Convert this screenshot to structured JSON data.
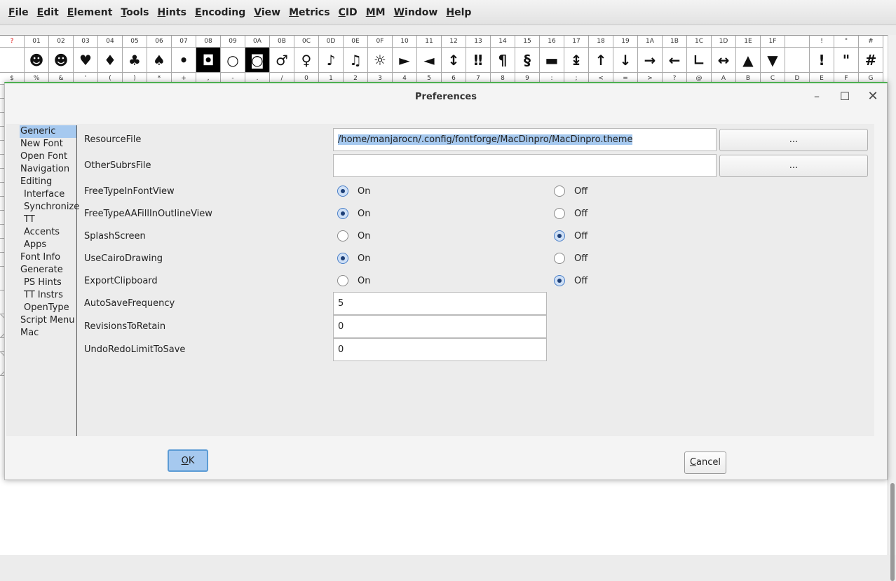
{
  "menubar": {
    "items": [
      {
        "mn": "F",
        "rest": "ile"
      },
      {
        "mn": "E",
        "rest": "dit"
      },
      {
        "mn": "E",
        "rest": "lement"
      },
      {
        "mn": "T",
        "rest": "ools"
      },
      {
        "mn": "H",
        "rest": "ints"
      },
      {
        "mn": "E",
        "rest": "ncoding"
      },
      {
        "mn": "V",
        "rest": "iew"
      },
      {
        "mn": "M",
        "rest": "etrics"
      },
      {
        "mn": "C",
        "rest": "ID"
      },
      {
        "mn": "M",
        "rest": "M"
      },
      {
        "mn": "W",
        "rest": "indow"
      },
      {
        "mn": "H",
        "rest": "elp"
      }
    ]
  },
  "fontview": {
    "labels": [
      "?",
      "01",
      "02",
      "03",
      "04",
      "05",
      "06",
      "07",
      "08",
      "09",
      "0A",
      "0B",
      "0C",
      "0D",
      "0E",
      "0F",
      "10",
      "11",
      "12",
      "13",
      "14",
      "15",
      "16",
      "17",
      "18",
      "19",
      "1A",
      "1B",
      "1C",
      "1D",
      "1E",
      "1F",
      "",
      "!",
      "\"",
      "#"
    ],
    "glyphs": [
      "",
      "☻",
      "☻",
      "♥",
      "♦",
      "♣",
      "♠",
      "•",
      "◘",
      "○",
      "◙",
      "♂",
      "♀",
      "♪",
      "♫",
      "☼",
      "►",
      "◄",
      "↕",
      "‼",
      "¶",
      "§",
      "▬",
      "↨",
      "↑",
      "↓",
      "→",
      "←",
      "∟",
      "↔",
      "▲",
      "▼",
      "",
      "!",
      "\"",
      "#"
    ],
    "labels2": [
      "$",
      "%",
      "&",
      "'",
      "(",
      ")",
      "*",
      "+",
      ",",
      "-",
      ".",
      "/",
      "0",
      "1",
      "2",
      "3",
      "4",
      "5",
      "6",
      "7",
      "8",
      "9",
      ":",
      ";",
      "<",
      "=",
      ">",
      "?",
      "@",
      "A",
      "B",
      "C",
      "D",
      "E",
      "F",
      "G"
    ]
  },
  "dialog": {
    "title": "Preferences",
    "controls": {
      "minimize": "–",
      "maximize": "☐",
      "close": "✕"
    },
    "sidebar": [
      {
        "label": "Generic",
        "sub": false,
        "selected": true
      },
      {
        "label": "New Font",
        "sub": false
      },
      {
        "label": "Open Font",
        "sub": false
      },
      {
        "label": "Navigation",
        "sub": false
      },
      {
        "label": "Editing",
        "sub": false
      },
      {
        "label": "Interface",
        "sub": true
      },
      {
        "label": "Synchronize",
        "sub": true
      },
      {
        "label": "TT",
        "sub": true
      },
      {
        "label": "Accents",
        "sub": true
      },
      {
        "label": "Apps",
        "sub": true
      },
      {
        "label": "Font Info",
        "sub": false
      },
      {
        "label": "Generate",
        "sub": false
      },
      {
        "label": "PS Hints",
        "sub": true
      },
      {
        "label": "TT Instrs",
        "sub": true
      },
      {
        "label": "OpenType",
        "sub": true
      },
      {
        "label": "Script Menu",
        "sub": false
      },
      {
        "label": "Mac",
        "sub": false
      }
    ],
    "resource_file": {
      "label": "ResourceFile",
      "value": "/home/manjarocn/.config/fontforge/MacDinpro/MacDinpro.theme",
      "browse": "..."
    },
    "other_subrs": {
      "label": "OtherSubrsFile",
      "value": "",
      "browse": "..."
    },
    "on_label": "On",
    "off_label": "Off",
    "toggles": [
      {
        "label": "FreeTypeInFontView",
        "value": "On"
      },
      {
        "label": "FreeTypeAAFillInOutlineView",
        "value": "On"
      },
      {
        "label": "SplashScreen",
        "value": "Off"
      },
      {
        "label": "UseCairoDrawing",
        "value": "On"
      },
      {
        "label": "ExportClipboard",
        "value": "Off"
      }
    ],
    "numbers": [
      {
        "label": "AutoSaveFrequency",
        "value": "5"
      },
      {
        "label": "RevisionsToRetain",
        "value": "0"
      },
      {
        "label": "UndoRedoLimitToSave",
        "value": "0"
      }
    ],
    "ok": {
      "mn": "O",
      "rest": "K"
    },
    "cancel": {
      "mn": "C",
      "rest": "ancel"
    }
  }
}
